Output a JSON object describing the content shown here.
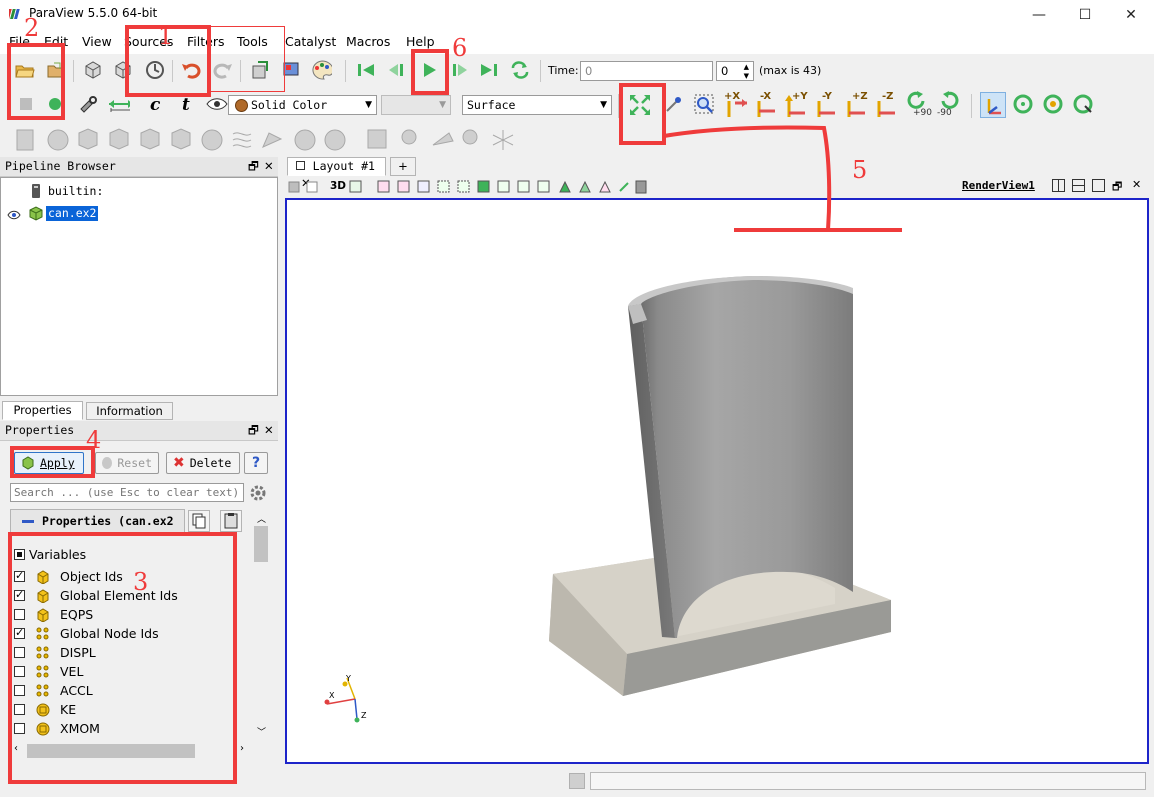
{
  "window": {
    "title": "ParaView 5.5.0 64-bit",
    "minimize": "—",
    "maximize": "☐",
    "close": "✕"
  },
  "menu": [
    "File",
    "Edit",
    "View",
    "Sources",
    "Filters",
    "Tools",
    "Catalyst",
    "Macros",
    "Help"
  ],
  "toolbar": {
    "time_label": "Time:",
    "time_value": "0",
    "timestep_value": "0",
    "max_label": "(max is 43)",
    "color_by": "Solid Color",
    "representation": "Surface",
    "camera_labels": [
      "+X",
      "-X",
      "+Y",
      "-Y",
      "+Z",
      "-Z"
    ],
    "rotate_pos": "+90",
    "rotate_neg": "-90",
    "c_label": "c",
    "t_label": "t"
  },
  "pipeline": {
    "title": "Pipeline Browser",
    "items": [
      {
        "label": "builtin:"
      },
      {
        "label": "can.ex2"
      }
    ]
  },
  "tabs": {
    "properties": "Properties",
    "information": "Information"
  },
  "properties": {
    "title": "Properties",
    "apply": "Apply",
    "reset": "Reset",
    "delete": "Delete",
    "help": "?",
    "search_placeholder": "Search ... (use Esc to clear text)",
    "section_title": "Properties (can.ex2",
    "variables_header": "Variables",
    "variables": [
      {
        "name": "Object Ids",
        "checked": true,
        "icon": "cell-icon"
      },
      {
        "name": "Global Element Ids",
        "checked": true,
        "icon": "cell-icon"
      },
      {
        "name": "EQPS",
        "checked": false,
        "icon": "cell-icon"
      },
      {
        "name": "Global Node Ids",
        "checked": true,
        "icon": "point-icon"
      },
      {
        "name": "DISPL",
        "checked": false,
        "icon": "point-icon"
      },
      {
        "name": "VEL",
        "checked": false,
        "icon": "point-icon"
      },
      {
        "name": "ACCL",
        "checked": false,
        "icon": "point-icon"
      },
      {
        "name": "KE",
        "checked": false,
        "icon": "field-icon"
      },
      {
        "name": "XMOM",
        "checked": false,
        "icon": "field-icon"
      }
    ]
  },
  "layout": {
    "tab_label": "Layout #1",
    "add_tab": "+",
    "view_label": "RenderView1",
    "mode_3d": "3D"
  },
  "axes": {
    "x": "X",
    "y": "Y",
    "z": "Z"
  },
  "annotations": {
    "n1": "1",
    "n2": "2",
    "n3": "3",
    "n4": "4",
    "n5": "5",
    "n6": "6"
  },
  "colors": {
    "annotation": "#ef3b3b",
    "view_border": "#1d24c9",
    "selection": "#0a64d8"
  }
}
